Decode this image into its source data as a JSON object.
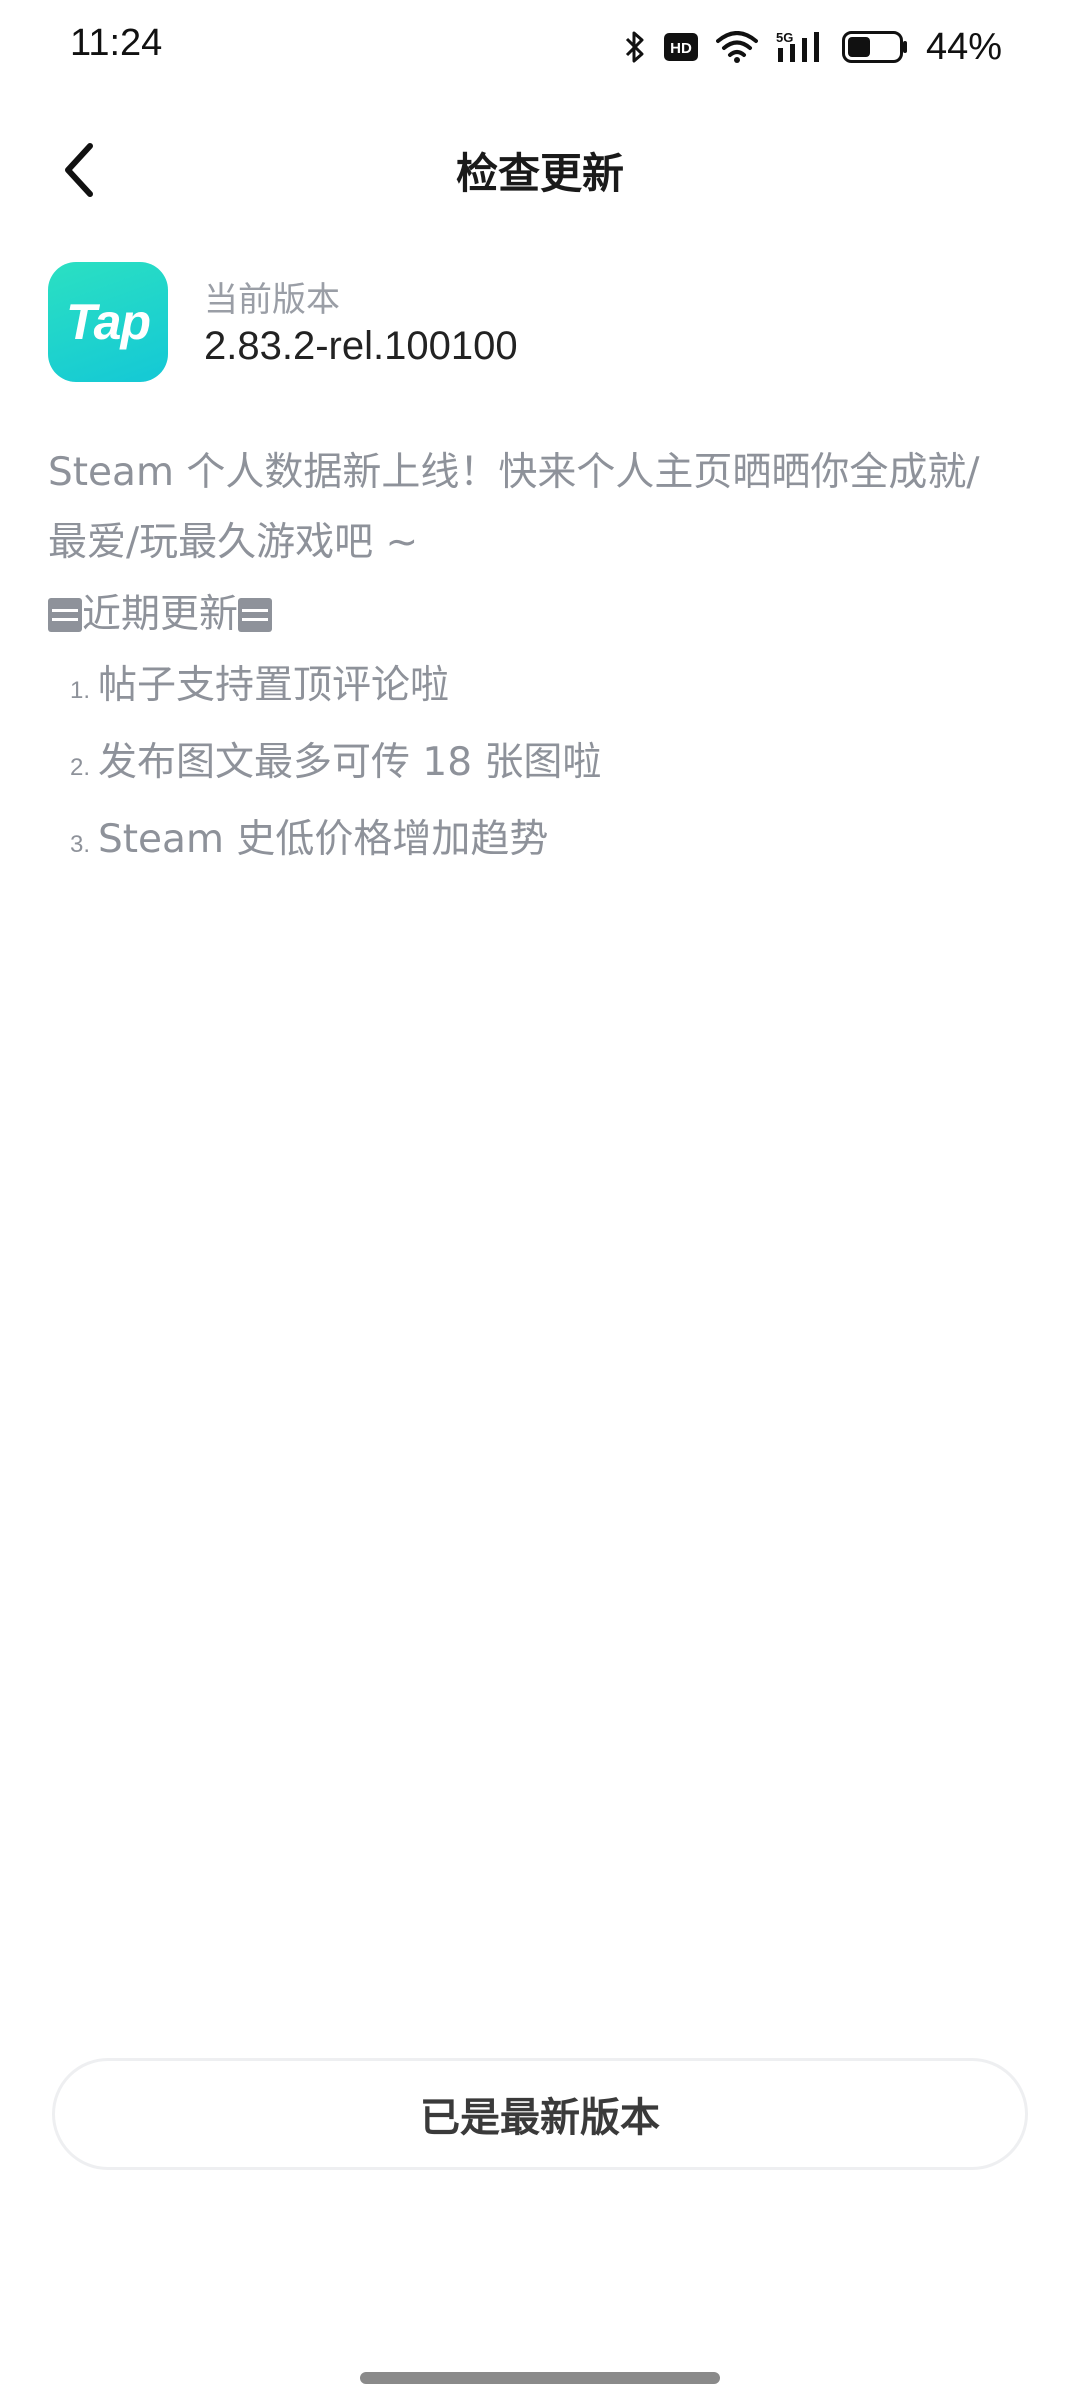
{
  "status_bar": {
    "time": "11:24",
    "battery_percent": "44%",
    "network_label": "5G",
    "hd_label": "HD",
    "battery_level": 0.44,
    "icons": [
      "bluetooth-icon",
      "hd-icon",
      "wifi-icon",
      "signal-5g-icon",
      "battery-icon"
    ]
  },
  "header": {
    "title": "检查更新",
    "back_icon": "chevron-left-icon"
  },
  "app": {
    "icon_text": "Tap",
    "version_label": "当前版本",
    "version_value": "2.83.2-rel.100100"
  },
  "changelog": {
    "intro": "Steam 个人数据新上线！快来个人主页晒晒你全成就/最爱/玩最久游戏吧 ~",
    "section_title": "近期更新",
    "items": [
      {
        "num": "1.",
        "text": "帖子支持置顶评论啦"
      },
      {
        "num": "2.",
        "text": "发布图文最多可传 18 张图啦"
      },
      {
        "num": "3.",
        "text": "Steam 史低价格增加趋势"
      }
    ]
  },
  "action": {
    "status_label": "已是最新版本"
  },
  "colors": {
    "accent_gradient_start": "#2be0c2",
    "accent_gradient_end": "#14c8d6",
    "muted_text": "#8e929a"
  }
}
